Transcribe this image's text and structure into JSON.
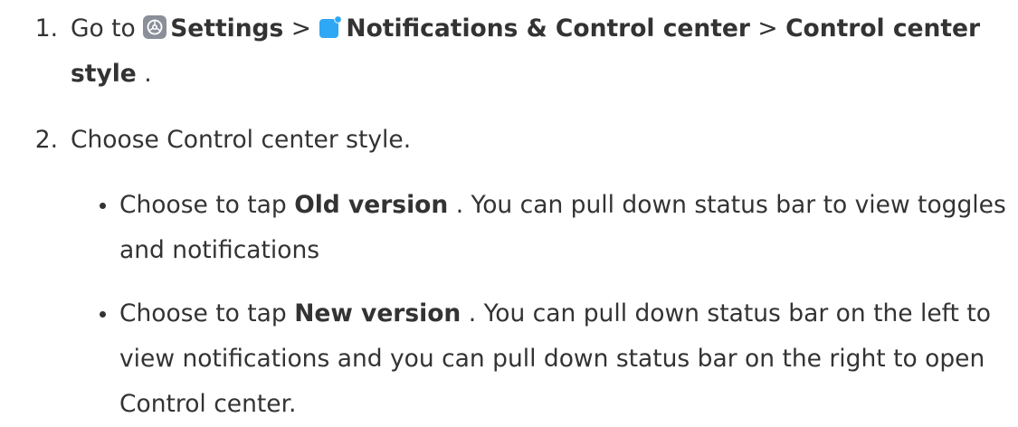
{
  "steps": [
    {
      "number": "1.",
      "go_to": "Go to",
      "settings_label": "Settings",
      "separator1": ">",
      "notifications_label": "Notifications & Control center",
      "separator2": ">",
      "control_center_label": "Control center style",
      "end_punct": "."
    },
    {
      "number": "2.",
      "text": "Choose Control center style."
    }
  ],
  "bullets": [
    {
      "prefix": "Choose to tap",
      "bold": "Old version",
      "suffix": ". You can pull down status bar to view toggles and notifications"
    },
    {
      "prefix": "Choose to tap",
      "bold": "New version",
      "suffix": ". You can pull down status bar on the left to view notifications and you can pull down status bar on the right to open Control center."
    }
  ],
  "icons": {
    "settings": "settings-gear-icon",
    "notifications": "notifications-icon",
    "settings_color": "#8a8f99",
    "notifications_color": "#2ea8f5"
  }
}
